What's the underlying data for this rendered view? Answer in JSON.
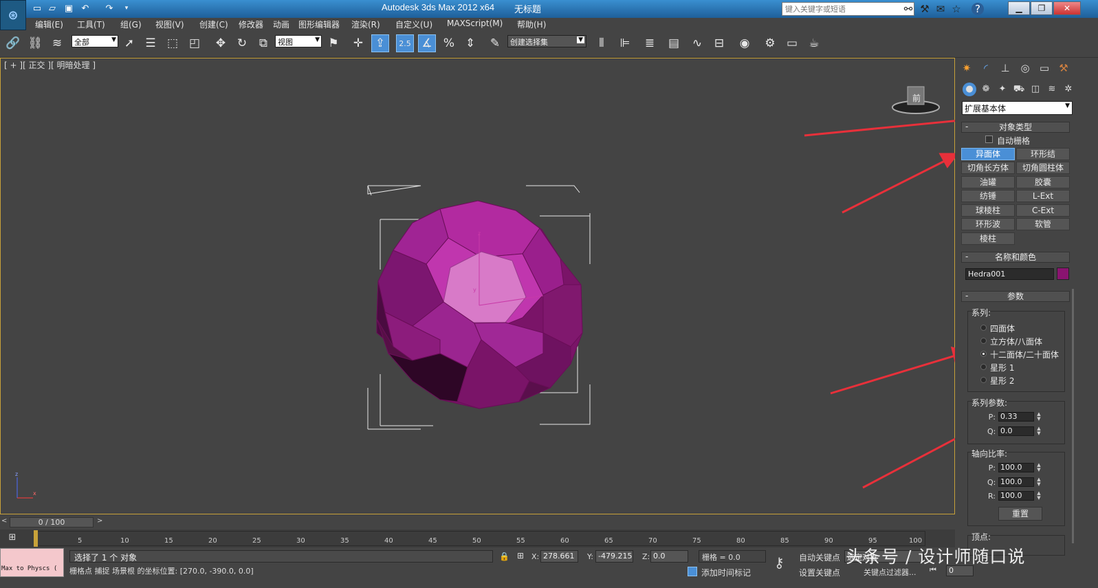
{
  "titlebar": {
    "app_title": "Autodesk 3ds Max  2012 x64",
    "file_title": "无标题",
    "search_placeholder": "键入关键字或短语"
  },
  "menu": [
    "编辑(E)",
    "工具(T)",
    "组(G)",
    "视图(V)",
    "创建(C)",
    "修改器",
    "动画",
    "图形编辑器",
    "渲染(R)",
    "自定义(U)",
    "MAXScript(M)",
    "帮助(H)"
  ],
  "toolbar": {
    "selection_filter": "全部",
    "ref_coord": "视图",
    "snap_label": "2.5",
    "named_selection": "创建选择集"
  },
  "viewport": {
    "label": "[ + ][ 正交 ][ 明暗处理 ]",
    "viewcube_face": "前"
  },
  "command_panel": {
    "category": "扩展基本体",
    "object_type_title": "对象类型",
    "autogrid_label": "自动栅格",
    "object_buttons": [
      "异面体",
      "环形结",
      "切角长方体",
      "切角圆柱体",
      "油罐",
      "胶囊",
      "纺锤",
      "L-Ext",
      "球棱柱",
      "C-Ext",
      "环形波",
      "软管",
      "棱柱"
    ],
    "selected_button": "异面体",
    "name_color_title": "名称和颜色",
    "object_name": "Hedra001",
    "object_color": "#8a1470",
    "params_title": "参数",
    "family_title": "系列:",
    "family_options": [
      "四面体",
      "立方体/八面体",
      "十二面体/二十面体",
      "星形 1",
      "星形 2"
    ],
    "family_selected_index": 2,
    "family_params_title": "系列参数:",
    "family_params": [
      {
        "label": "P:",
        "value": "0.33"
      },
      {
        "label": "Q:",
        "value": "0.0"
      }
    ],
    "axis_scale_title": "轴向比率:",
    "axis_scale": [
      {
        "label": "P:",
        "value": "100.0"
      },
      {
        "label": "Q:",
        "value": "100.0"
      },
      {
        "label": "R:",
        "value": "100.0"
      }
    ],
    "reset_label": "重置",
    "vertices_title": "顶点:"
  },
  "timeline": {
    "frame_display": "0 / 100",
    "ticks": [
      "5",
      "10",
      "15",
      "20",
      "25",
      "30",
      "35",
      "40",
      "45",
      "50",
      "55",
      "60",
      "65",
      "70",
      "75",
      "80",
      "85",
      "90",
      "95",
      "100"
    ]
  },
  "status": {
    "maxscript": "Max to Physcs (",
    "selection": "选择了 1 个 对象",
    "prompt": "栅格点 捕捉 场景根 的坐标位置: [270.0, -390.0, 0.0]",
    "x_label": "X:",
    "x_value": "278.661",
    "y_label": "Y:",
    "y_value": "-479.215",
    "z_label": "Z:",
    "z_value": "0.0",
    "grid": "栅格 = 0.0",
    "auto_key": "自动关键点",
    "set_key": "设置关键点",
    "add_time_tag": "添加时间标记",
    "key_filters": "关键点过滤器...",
    "selected_objects": "选定对象",
    "frame": "0"
  },
  "watermark": "头条号 / 设计师随口说",
  "colors": {
    "accent": "#4a8fd6",
    "viewport_border": "#c8a23a",
    "arrow": "#e8303a",
    "gizmo": "#b02aa0"
  }
}
